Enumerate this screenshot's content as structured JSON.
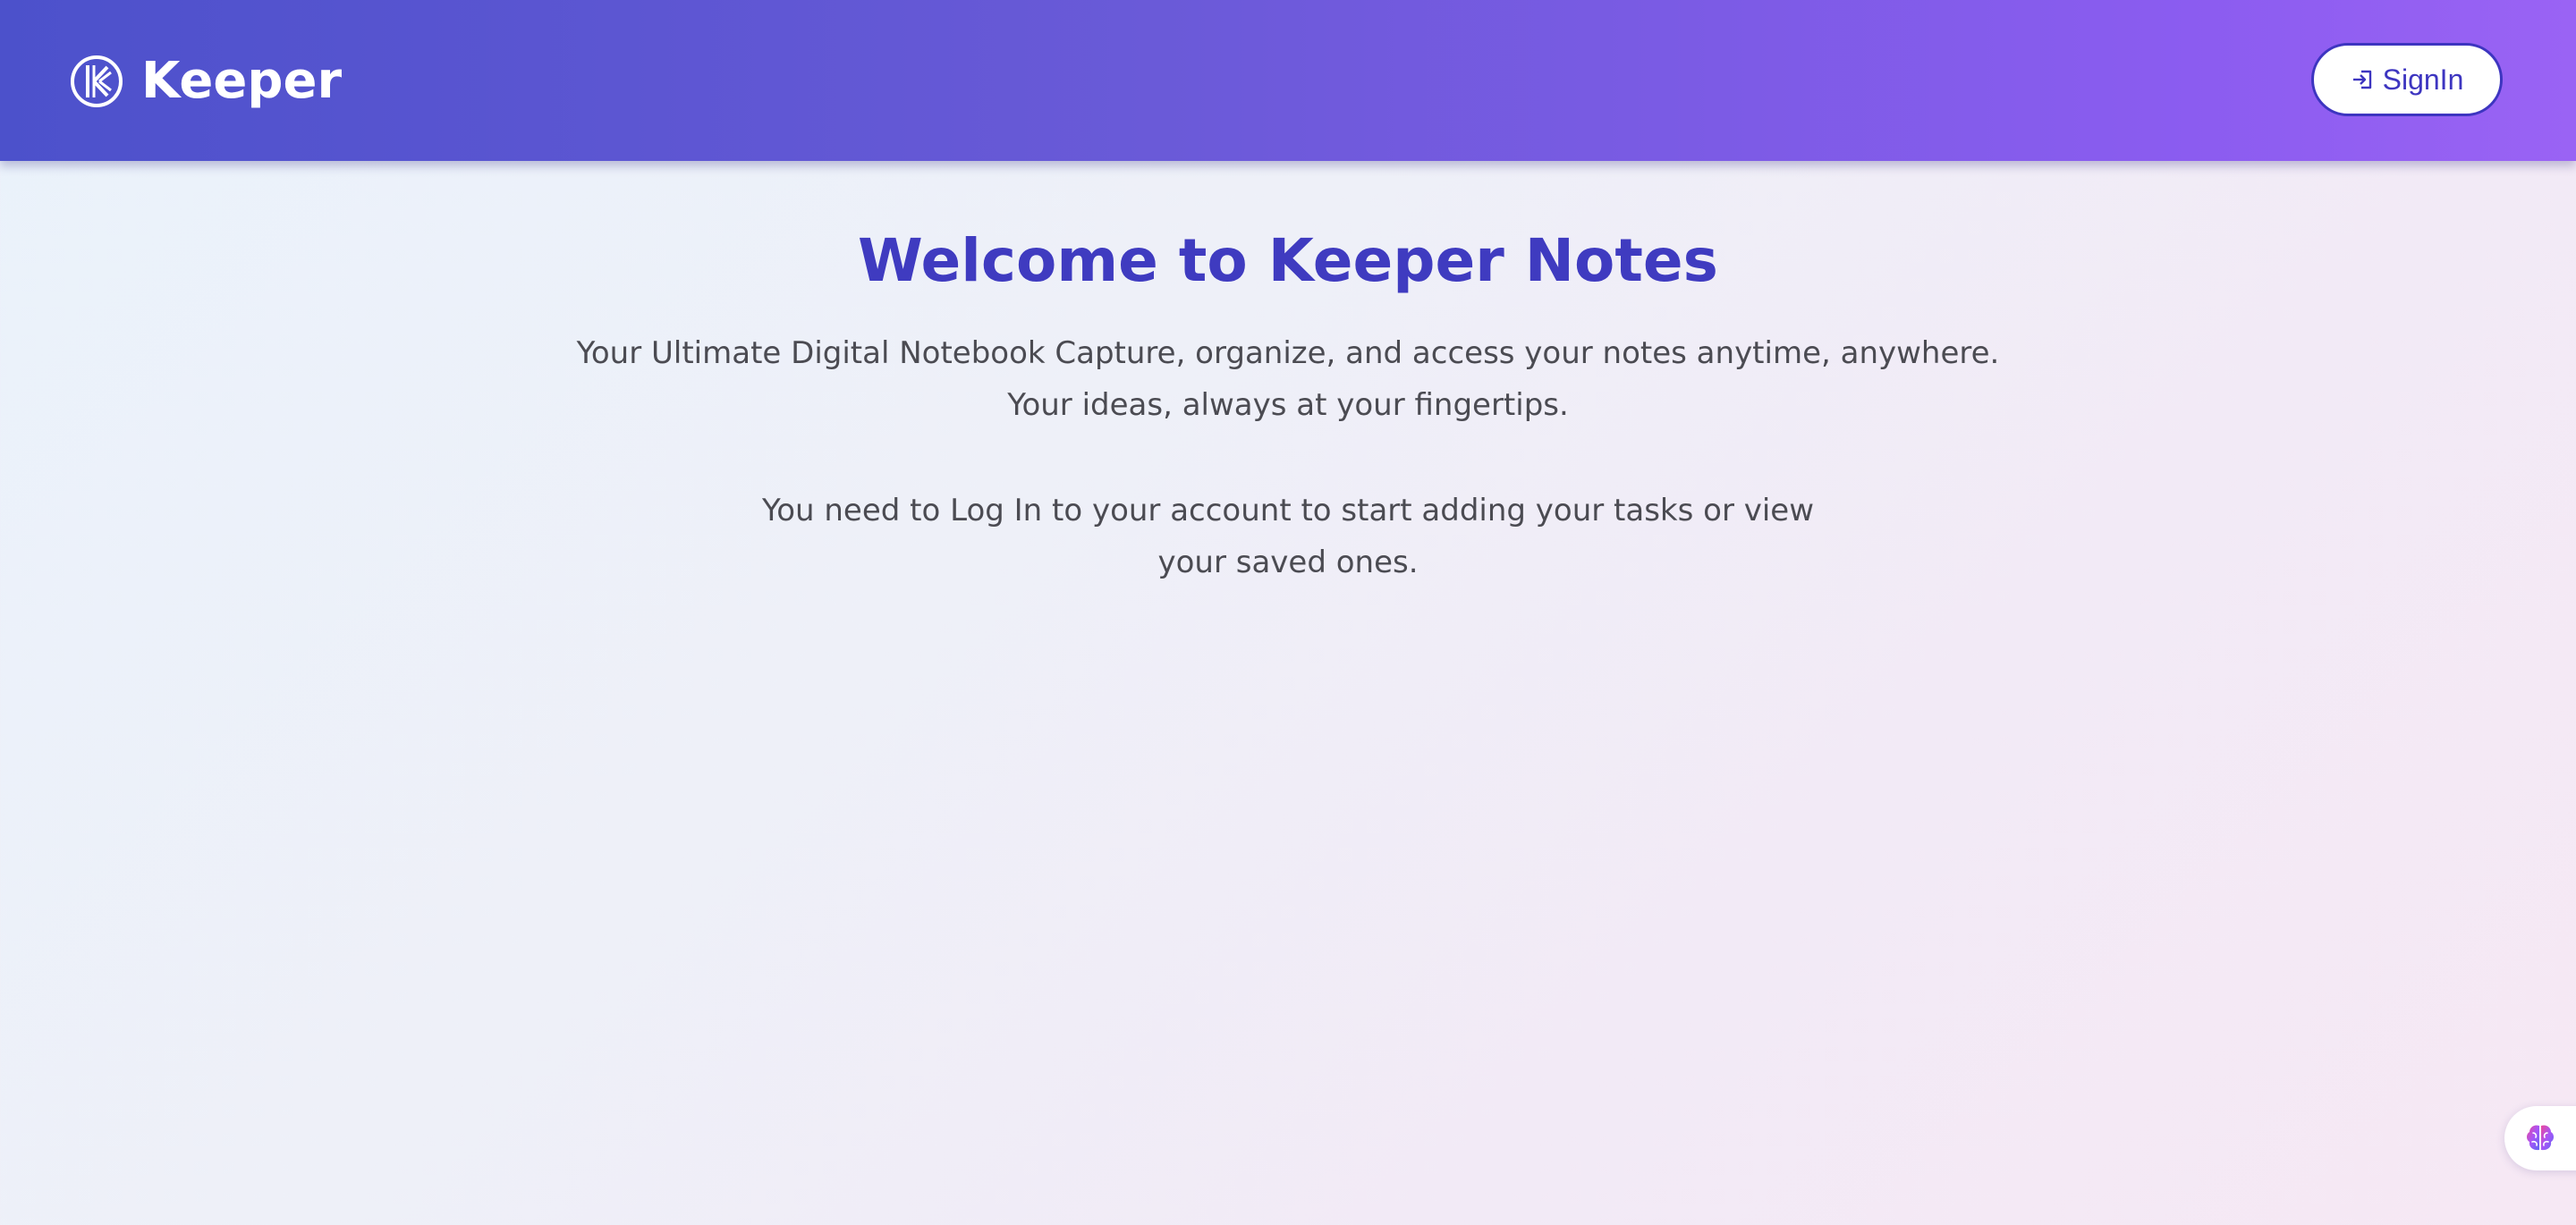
{
  "header": {
    "brand_name": "Keeper",
    "brand_icon": "keeper-logo-icon",
    "signin_label": "SignIn",
    "signin_icon": "login-arrow-icon",
    "colors": {
      "gradient_start": "#4c51cb",
      "gradient_end": "#9a63f4",
      "button_accent": "#3d35c0"
    }
  },
  "main": {
    "title": "Welcome to Keeper Notes",
    "tagline": "Your Ultimate Digital Notebook Capture, organize, and access your notes anytime, anywhere. Your ideas, always at your fingertips.",
    "login_message": "You need to Log In to your account to start adding your tasks or view your saved ones.",
    "colors": {
      "title": "#3f3bc0",
      "body_text": "#4b4b52"
    }
  },
  "floating_widget": {
    "icon": "brain-icon"
  }
}
